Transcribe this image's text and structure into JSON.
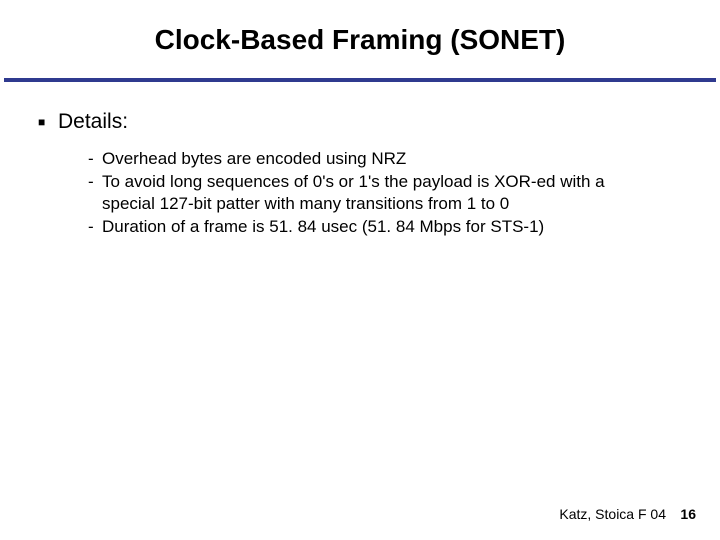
{
  "title": "Clock-Based Framing (SONET)",
  "section_label": "Details:",
  "bullets": [
    "Overhead bytes are encoded using NRZ",
    "To avoid long sequences of 0's or 1's the payload is XOR-ed with a special 127-bit patter with many transitions from 1 to 0",
    "Duration of a frame is 51. 84 usec (51. 84 Mbps for STS-1)"
  ],
  "footer": {
    "text": "Katz, Stoica F 04",
    "page": "16"
  }
}
